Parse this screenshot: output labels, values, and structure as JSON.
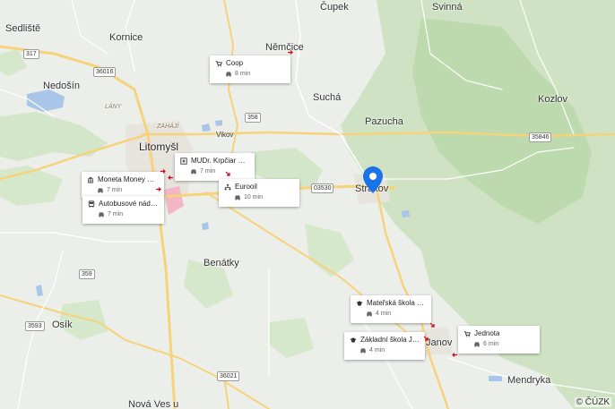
{
  "places": {
    "cupek": "Čupek",
    "svinna": "Svinná",
    "sedliste": "Sedliště",
    "kornice": "Kornice",
    "nemcice": "Němčice",
    "nedosin": "Nedošín",
    "such": "Suchá",
    "kozlov": "Kozlov",
    "pazucha": "Pazucha",
    "litomysl": "Litomyšl",
    "strakov": "Strakov",
    "benatky": "Benátky",
    "osik": "Osík",
    "janov": "Janov",
    "mendryka": "Mendryka",
    "nova_ves": "Nová Ves u",
    "lany": "LÁNY",
    "zahaji": "ZAHÁJÍ",
    "vikov": "Vikov"
  },
  "roads": {
    "r317": "317",
    "r36016": "36016",
    "r358": "358",
    "r35846": "35846",
    "r03530": "03530",
    "r359": "359",
    "r3593": "3593",
    "r36021": "36021"
  },
  "pois": [
    {
      "title": "Coop",
      "time": "8 min",
      "icon": "cart-icon"
    },
    {
      "title": "MUDr. Krpčiar Pa…",
      "time": "7 min",
      "icon": "medical-icon"
    },
    {
      "title": "Moneta Money B…",
      "time": "7 min",
      "icon": "bank-icon"
    },
    {
      "title": "Eurooil",
      "time": "10 min",
      "icon": "fuel-network-icon"
    },
    {
      "title": "Autobusové nádr…",
      "time": "7 min",
      "icon": "bus-icon"
    },
    {
      "title": "Mateřská škola Ja…",
      "time": "4 min",
      "icon": "school-icon"
    },
    {
      "title": "Základní škola Ja…",
      "time": "4 min",
      "icon": "school-icon"
    },
    {
      "title": "Jednota",
      "time": "6 min",
      "icon": "cart-icon"
    }
  ],
  "copyright": "© ČÚZK",
  "colors": {
    "pin": "#1a73e8",
    "road": "#f6d27a",
    "water": "#a9c5e8",
    "forest": "#c9e0bf",
    "arrow": "#d0021b"
  }
}
